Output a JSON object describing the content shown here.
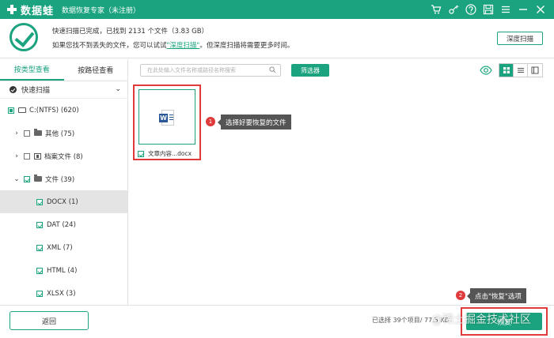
{
  "app": {
    "logo_text": "数据蛙",
    "title": "数据恢复专家（未注册）",
    "brand_color": "#1aa37e"
  },
  "titlebar_icons": [
    "cart-icon",
    "key-icon",
    "help-icon",
    "save-icon",
    "menu-icon",
    "minimize-icon",
    "close-icon"
  ],
  "status": {
    "line1": "快速扫描已完成，已找到 2131 个文件（3.83 GB）",
    "line2_prefix": "如果您找不到丢失的文件，您可以试试",
    "line2_link": "\"深度扫描\"",
    "line2_suffix": "。但深度扫描将需要更多时间。",
    "deep_scan_button": "深度扫描"
  },
  "sidebar": {
    "tabs": [
      {
        "label": "按类型查看",
        "active": true
      },
      {
        "label": "按路径查看",
        "active": false
      }
    ],
    "scan_mode": "快速扫描",
    "tree": [
      {
        "label": "C:(NTFS) (620)",
        "level": 0
      },
      {
        "label": "其他 (75)",
        "level": 1
      },
      {
        "label": "档案文件 (8)",
        "level": 1
      },
      {
        "label": "文件 (39)",
        "level": 1
      },
      {
        "label": "DOCX (1)",
        "level": 2,
        "selected": true
      },
      {
        "label": "DAT (24)",
        "level": 2
      },
      {
        "label": "XML (7)",
        "level": 2
      },
      {
        "label": "HTML (4)",
        "level": 2
      },
      {
        "label": "XLSX (3)",
        "level": 2
      }
    ]
  },
  "toolbar": {
    "search_placeholder": "在此处输入文件名称或路径名称搜索",
    "filter_button": "筛选器"
  },
  "files": [
    {
      "name": "文章内容...docx",
      "checked": true
    }
  ],
  "callouts": {
    "step1_num": "1",
    "step1_text": "选择好要恢复的文件",
    "step2_num": "2",
    "step2_text": "点击\"恢复\"选项"
  },
  "bottom": {
    "back_button": "返回",
    "selected_info": "已选择 39个项目/ 77.5 KB",
    "recover_button": "恢复"
  },
  "watermark": "@稀土掘金技术社区"
}
